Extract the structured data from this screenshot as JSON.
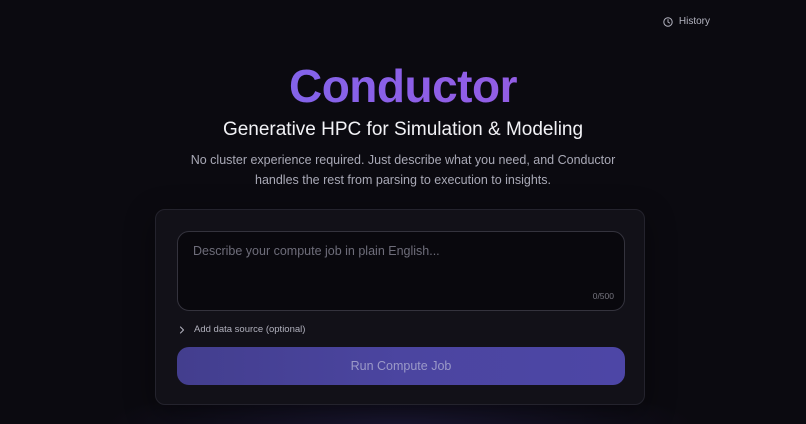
{
  "header": {
    "history_label": "History",
    "history_icon": "clock-icon"
  },
  "hero": {
    "brand": "Conductor",
    "subtitle": "Generative HPC for Simulation & Modeling",
    "description": "No cluster experience required. Just describe what you need, and Conductor handles the rest from parsing to execution to insights."
  },
  "form": {
    "input_value": "",
    "input_placeholder": "Describe your compute job in plain English...",
    "counter": "0/500",
    "data_source_label": "Add data source (optional)",
    "data_source_icon": "chevron-right-icon",
    "submit_label": "Run Compute Job"
  },
  "colors": {
    "background": "#0b0a10",
    "brand_gradient_start": "#6d6df0",
    "brand_gradient_end": "#a05ae0",
    "button": "#4b45a0",
    "button_text": "#9b99c8"
  }
}
